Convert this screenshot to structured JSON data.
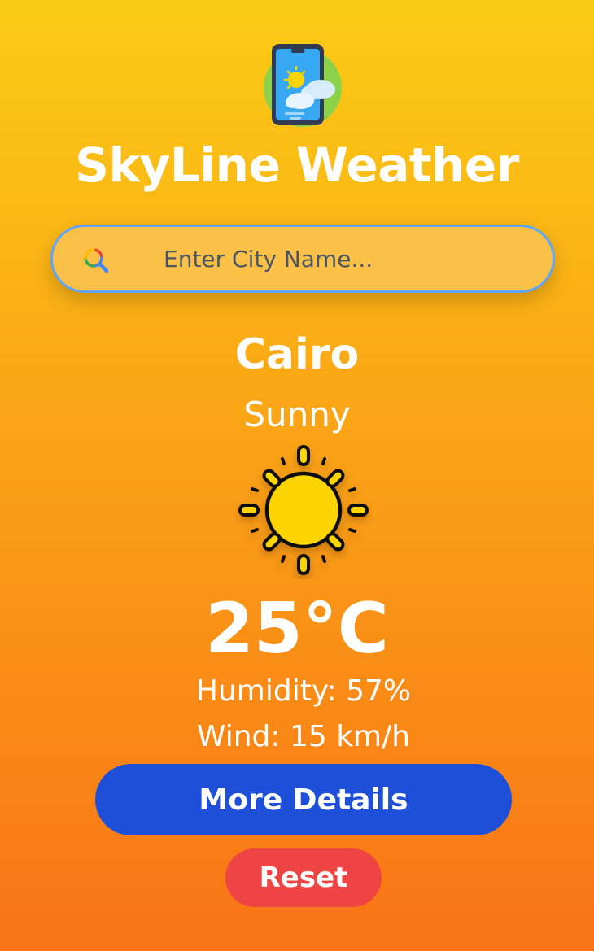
{
  "app": {
    "title": "SkyLine Weather",
    "logo_icon": "phone-weather-icon"
  },
  "search": {
    "placeholder": "Enter City Name...",
    "value": "",
    "icon": "search-icon"
  },
  "weather": {
    "city": "Cairo",
    "condition": "Sunny",
    "icon": "sun-icon",
    "temperature": "25°C",
    "humidity": "Humidity: 57%",
    "wind": "Wind: 15 km/h"
  },
  "actions": {
    "more_details_label": "More Details",
    "reset_label": "Reset"
  },
  "colors": {
    "background_top": "#facc15",
    "background_bottom": "#f97316",
    "search_border": "#60a5fa",
    "primary_button": "#1d4fd8",
    "reset_button": "#ef4444",
    "sun": "#fcd400"
  }
}
